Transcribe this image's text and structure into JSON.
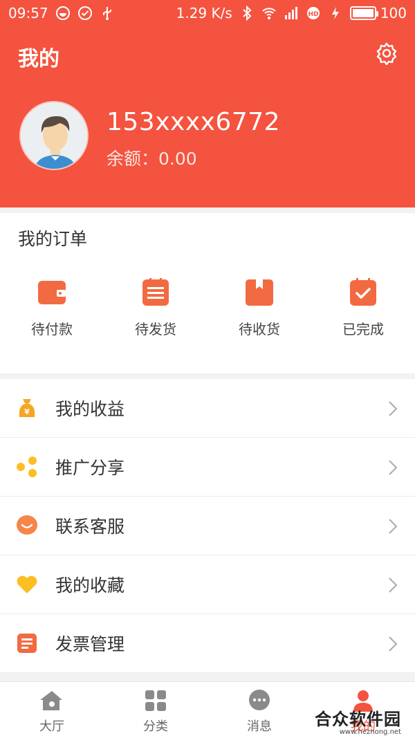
{
  "status_bar": {
    "time": "09:57",
    "speed": "1.29 K/s",
    "battery": "100",
    "battery_level": 1.0
  },
  "header": {
    "title": "我的",
    "phone": "153xxxx6772",
    "balance": "余额：0.00"
  },
  "orders": {
    "title": "我的订单",
    "items": [
      {
        "label": "待付款",
        "icon": "wallet-icon"
      },
      {
        "label": "待发货",
        "icon": "list-icon"
      },
      {
        "label": "待收货",
        "icon": "package-icon"
      },
      {
        "label": "已完成",
        "icon": "check-icon"
      }
    ]
  },
  "menu": {
    "items": [
      {
        "label": "我的收益",
        "icon": "money-bag-icon"
      },
      {
        "label": "推广分享",
        "icon": "share-icon"
      },
      {
        "label": "联系客服",
        "icon": "chat-bubble-icon"
      },
      {
        "label": "我的收藏",
        "icon": "heart-icon"
      },
      {
        "label": "发票管理",
        "icon": "invoice-icon"
      }
    ]
  },
  "tabbar": {
    "items": [
      {
        "label": "大厅",
        "icon": "home-icon"
      },
      {
        "label": "分类",
        "icon": "grid-icon"
      },
      {
        "label": "消息",
        "icon": "message-icon"
      },
      {
        "label": "我的",
        "icon": "person-icon"
      }
    ],
    "active_index": 3
  },
  "watermark": {
    "main": "合众软件园",
    "sub": "www.hezhong.net"
  },
  "colors": {
    "accent": "#f4533f",
    "orange": "#f26a41",
    "yellow": "#fbbf24"
  }
}
